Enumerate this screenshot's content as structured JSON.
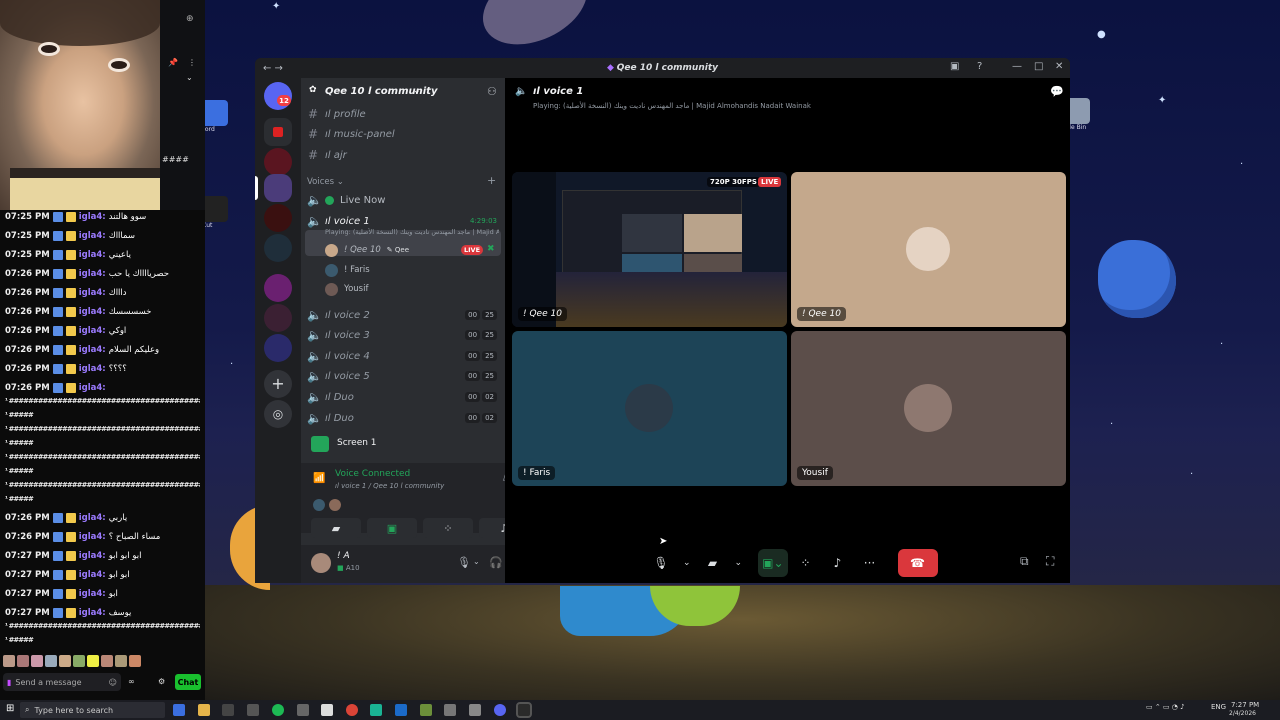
{
  "desktop": {
    "icon_labels": [
      "word",
      "Cut",
      "cle Bin"
    ]
  },
  "stream_chat": {
    "lines": [
      {
        "time": "07:25 PM",
        "user": "igla4:",
        "msg": "سوو هالتند"
      },
      {
        "time": "07:25 PM",
        "user": "igla4:",
        "msg": "سماااك"
      },
      {
        "time": "07:25 PM",
        "user": "igla4:",
        "msg": "ياعيني"
      },
      {
        "time": "07:26 PM",
        "user": "igla4:",
        "msg": "حصريااااك يا حب"
      },
      {
        "time": "07:26 PM",
        "user": "igla4:",
        "msg": "داااك"
      },
      {
        "time": "07:26 PM",
        "user": "igla4:",
        "msg": "خسسسسك"
      },
      {
        "time": "07:26 PM",
        "user": "igla4:",
        "msg": "اوكي"
      },
      {
        "time": "07:26 PM",
        "user": "igla4:",
        "msg": "وعليكم السلام"
      },
      {
        "time": "07:26 PM",
        "user": "igla4:",
        "msg": "؟؟؟؟"
      },
      {
        "time": "07:26 PM",
        "user": "igla4:",
        "msg": ""
      }
    ],
    "hash_lines": [
      "¹ ########################################",
      "¹ #####",
      "¹ ########################################",
      "¹ #####",
      "¹ ########################################",
      "¹ #####",
      "¹ ########################################",
      "¹ #####"
    ],
    "lines2": [
      {
        "time": "07:26 PM",
        "user": "igla4:",
        "msg": "ياربي"
      },
      {
        "time": "07:26 PM",
        "user": "igla4:",
        "msg": "مساء الصباح ؟"
      },
      {
        "time": "07:27 PM",
        "user": "igla4:",
        "msg": "ابو ابو ابو"
      },
      {
        "time": "07:27 PM",
        "user": "igla4:",
        "msg": "ابو ابو"
      },
      {
        "time": "07:27 PM",
        "user": "igla4:",
        "msg": "ابو"
      },
      {
        "time": "07:27 PM",
        "user": "igla4:",
        "msg": "يوسف"
      }
    ],
    "hash_lines2": [
      "¹ ########################################",
      "¹ #####"
    ],
    "input_placeholder": "Send a message",
    "chat_button": "Chat"
  },
  "discord": {
    "window_title_prefix": "",
    "window_title": "Qee 10 l community",
    "guild_name": "Qee 10 l community",
    "text_channels": [
      {
        "name": "ıl profile"
      },
      {
        "name": "ıl music-panel"
      },
      {
        "name": "ıl ajr"
      }
    ],
    "voices_header": "Voices",
    "voice_channels": [
      {
        "name": "Live Now",
        "kind": "live"
      },
      {
        "name": "ıl voice 1",
        "kind": "active",
        "timer": "4:29:03",
        "sub": "Playing: (النسخة الأصلية) ماجد المهندس ناديت وينك | Majid Alm..."
      },
      {
        "name": "ıl voice 2",
        "c1": "00",
        "c2": "25"
      },
      {
        "name": "ıl voice 3",
        "c1": "00",
        "c2": "25"
      },
      {
        "name": "ıl voice 4",
        "c1": "00",
        "c2": "25"
      },
      {
        "name": "ıl voice 5",
        "c1": "00",
        "c2": "25"
      },
      {
        "name": "ıl Duo",
        "c1": "00",
        "c2": "02"
      },
      {
        "name": "ıl Duo",
        "c1": "00",
        "c2": "02"
      }
    ],
    "members": [
      {
        "name": "! Qee 10",
        "tag": "Qee",
        "live": "LIVE"
      },
      {
        "name": "! Faris"
      },
      {
        "name": "Yousif"
      }
    ],
    "screen_panel": {
      "label": "Screen 1"
    },
    "voice_panel": {
      "status": "Voice Connected",
      "sub": "ıl voice 1 / Qee 10 l community"
    },
    "user_panel": {
      "name": "! A",
      "status": "A10"
    },
    "call": {
      "channel": "ıl voice 1",
      "playing": "Playing: (النسخة الأصلية) ماجد المهندس ناديت وينك | Majid Almohandis Nadait Wainak",
      "tiles": [
        {
          "label": "! Qee 10",
          "quality": "720P 30FPS",
          "live": "LIVE"
        },
        {
          "label": "! Qee 10"
        },
        {
          "label": "! Faris"
        },
        {
          "label": "Yousif"
        }
      ]
    }
  },
  "taskbar": {
    "search_placeholder": "Type here to search",
    "lang": "ENG",
    "time": "7:27 PM",
    "date": "2/4/2026"
  },
  "colors": {
    "discord_green": "#23a55a",
    "live_red": "#da373c",
    "chat_user": "#9b7bff",
    "chat_btn": "#19c02e"
  }
}
